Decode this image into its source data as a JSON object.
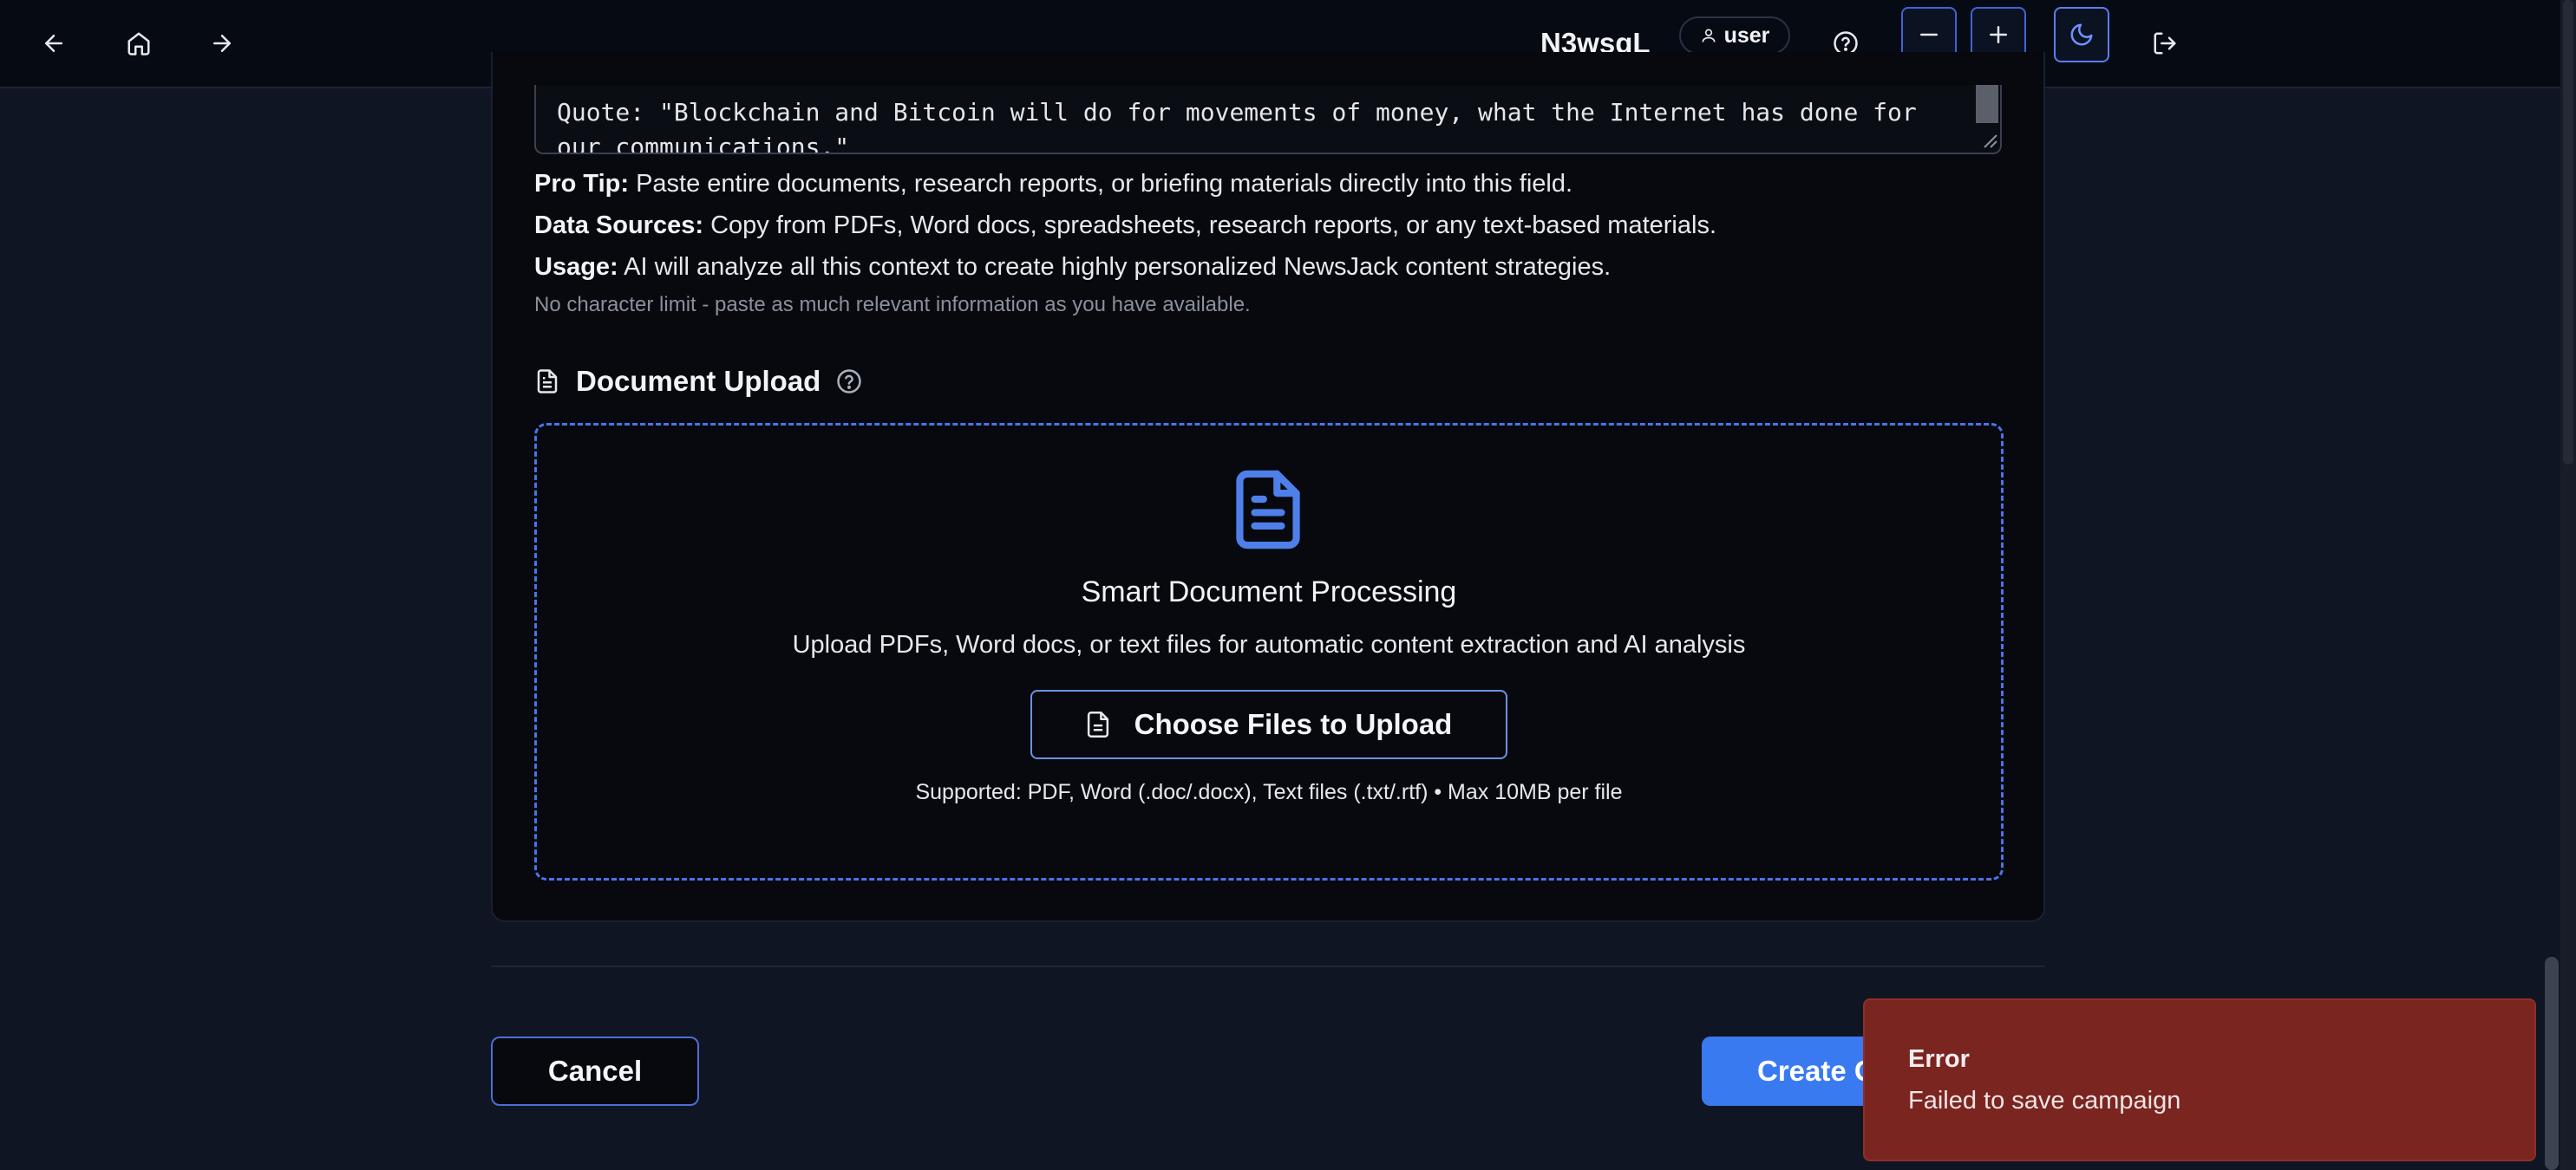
{
  "nav": {
    "brand": "N3wsgL",
    "user_label": "user"
  },
  "editor": {
    "text": "Quote: \"Blockchain and Bitcoin will do for movements of money, what the Internet has done for",
    "text_line2": "our communications.\""
  },
  "tips": {
    "pro_tip_label": "Pro Tip:",
    "pro_tip_text": " Paste entire documents, research reports, or briefing materials directly into this field.",
    "sources_label": "Data Sources:",
    "sources_text": " Copy from PDFs, Word docs, spreadsheets, research reports, or any text-based materials.",
    "usage_label": "Usage:",
    "usage_text": " AI will analyze all this context to create highly personalized NewsJack content strategies.",
    "hint": "No character limit - paste as much relevant information as you have available."
  },
  "upload": {
    "section_title": "Document Upload",
    "title": "Smart Document Processing",
    "description": "Upload PDFs, Word docs, or text files for automatic content extraction and AI analysis",
    "button_label": "Choose Files to Upload",
    "supported": "Supported: PDF, Word (.doc/.docx), Text files (.txt/.rtf) • Max 10MB per file"
  },
  "actions": {
    "cancel_label": "Cancel",
    "create_label": "Create C"
  },
  "toast": {
    "title": "Error",
    "message": "Failed to save campaign"
  },
  "colors": {
    "accent": "#3a7af0",
    "error": "#7a2520",
    "background": "#0f1522"
  }
}
